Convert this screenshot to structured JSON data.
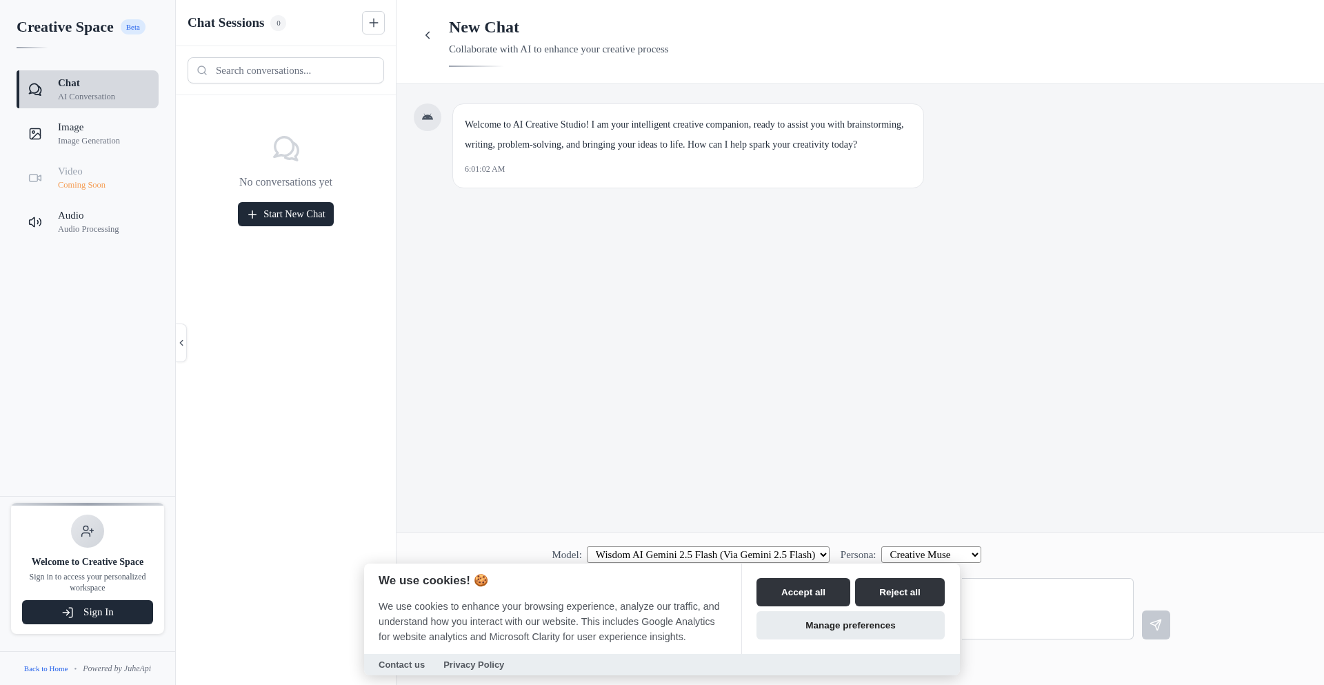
{
  "sidebar": {
    "brand": {
      "title": "Creative Space",
      "badge": "Beta"
    },
    "nav_items": [
      {
        "kind": "chat",
        "label": "Chat",
        "sublabel": "AI Conversation",
        "selected": true,
        "disabled": false
      },
      {
        "kind": "image",
        "label": "Image",
        "sublabel": "Image Generation",
        "selected": false,
        "disabled": false
      },
      {
        "kind": "video",
        "label": "Video",
        "sublabel": "Coming Soon",
        "selected": false,
        "disabled": true
      },
      {
        "kind": "audio",
        "label": "Audio",
        "sublabel": "Audio Processing",
        "selected": false,
        "disabled": false
      }
    ],
    "sign_in_card": {
      "title": "Welcome to Creative Space",
      "text": "Sign in to access your personalized workspace",
      "button": "Sign In"
    },
    "footer": {
      "link": "Back to Home",
      "separator": "•",
      "powered_by": "Powered by JuheApi"
    }
  },
  "sessions_panel": {
    "title": "Chat Sessions",
    "count": "0",
    "search": {
      "placeholder": "Search conversations..."
    },
    "empty_state": {
      "message": "No conversations yet",
      "button": "Start New Chat"
    }
  },
  "chat": {
    "title": "New Chat",
    "subtitle": "Collaborate with AI to enhance your creative process",
    "messages": [
      {
        "text": "Welcome to AI Creative Studio! I am your intelligent creative companion, ready to assist you with brainstorming, writing, problem-solving, and bringing your ideas to life. How can I help spark your creativity today?",
        "time": "6:01:02 AM"
      }
    ],
    "composer": {
      "model_label": "Model:",
      "model": "Wisdom AI Gemini 2.5 Flash (Via Gemini 2.5 Flash)",
      "persona_label": "Persona:",
      "persona": "Creative Muse"
    }
  },
  "cookie_banner": {
    "title": "We use cookies! 🍪",
    "text": "We use cookies to enhance your browsing experience, analyze our traffic, and understand how you interact with our website. This includes Google Analytics for website analytics and Microsoft Clarity for user experience insights.",
    "buttons": [
      {
        "kind": "primary",
        "label": "Accept all"
      },
      {
        "kind": "primary",
        "label": "Reject all"
      },
      {
        "kind": "secondary",
        "label": "Manage preferences"
      }
    ],
    "links": [
      "Contact us",
      "Privacy Policy"
    ]
  }
}
